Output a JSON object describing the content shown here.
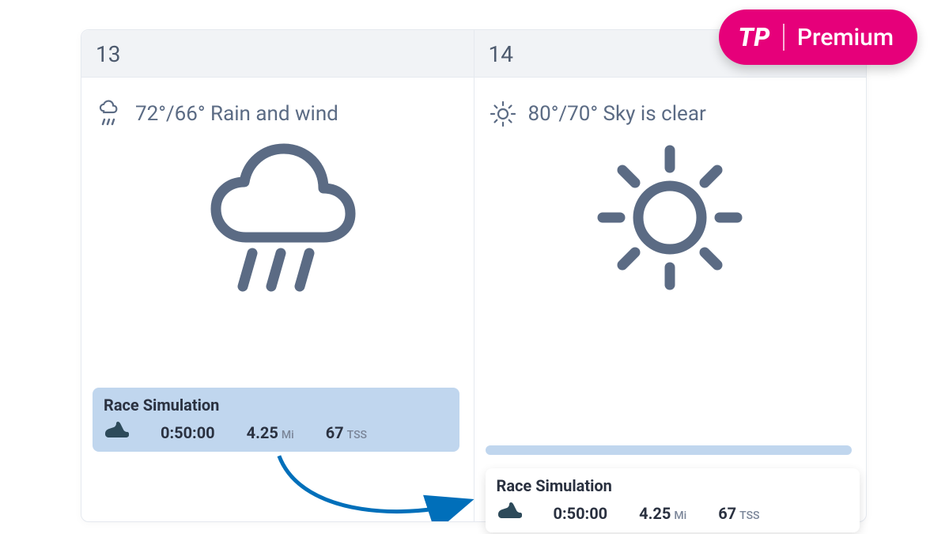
{
  "badge": {
    "brand": "TP",
    "label": "Premium"
  },
  "days": [
    {
      "date": "13",
      "weather_text": "72°/66° Rain and wind"
    },
    {
      "date": "14",
      "weather_text": "80°/70° Sky is clear"
    }
  ],
  "workout": {
    "title": "Race Simulation",
    "duration": "0:50:00",
    "distance_val": "4.25",
    "distance_unit": "Mi",
    "tss_val": "67",
    "tss_unit": "TSS"
  }
}
